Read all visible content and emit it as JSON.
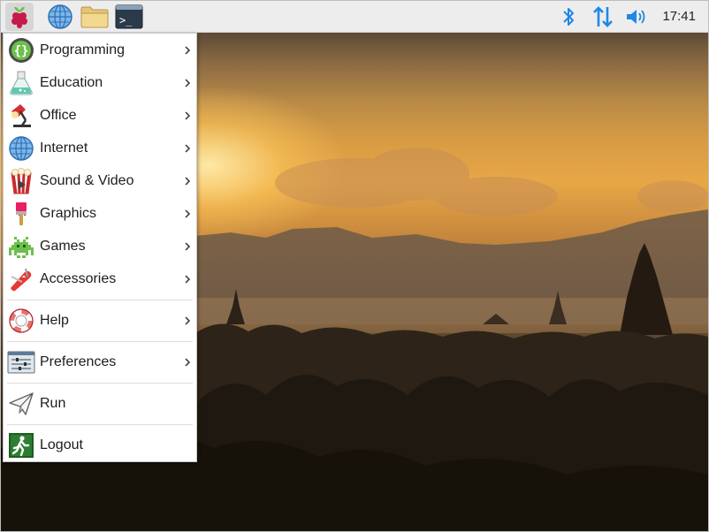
{
  "panel": {
    "launchers": [
      {
        "name": "raspberry-menu-icon"
      },
      {
        "name": "web-browser-icon"
      },
      {
        "name": "file-manager-icon"
      },
      {
        "name": "terminal-icon",
        "glyph": ">_"
      }
    ],
    "tray": [
      "bluetooth-icon",
      "network-icon",
      "volume-icon"
    ],
    "clock": "17:41"
  },
  "menu": {
    "items": [
      {
        "label": "Programming",
        "icon": "programming-icon",
        "submenu": true
      },
      {
        "label": "Education",
        "icon": "education-icon",
        "submenu": true
      },
      {
        "label": "Office",
        "icon": "office-icon",
        "submenu": true
      },
      {
        "label": "Internet",
        "icon": "internet-icon",
        "submenu": true
      },
      {
        "label": "Sound & Video",
        "icon": "sound-video-icon",
        "submenu": true
      },
      {
        "label": "Graphics",
        "icon": "graphics-icon",
        "submenu": true
      },
      {
        "label": "Games",
        "icon": "games-icon",
        "submenu": true
      },
      {
        "label": "Accessories",
        "icon": "accessories-icon",
        "submenu": true
      },
      {
        "label": "Help",
        "icon": "help-icon",
        "submenu": true
      },
      {
        "label": "Preferences",
        "icon": "preferences-icon",
        "submenu": true
      },
      {
        "label": "Run",
        "icon": "run-icon",
        "submenu": false
      },
      {
        "label": "Logout",
        "icon": "logout-icon",
        "submenu": false
      }
    ]
  },
  "colors": {
    "panel_bg": "#ededed",
    "accent_blue": "#1e88e5",
    "raspberry_red": "#c51a4a",
    "leaf_green": "#6cc04a"
  }
}
